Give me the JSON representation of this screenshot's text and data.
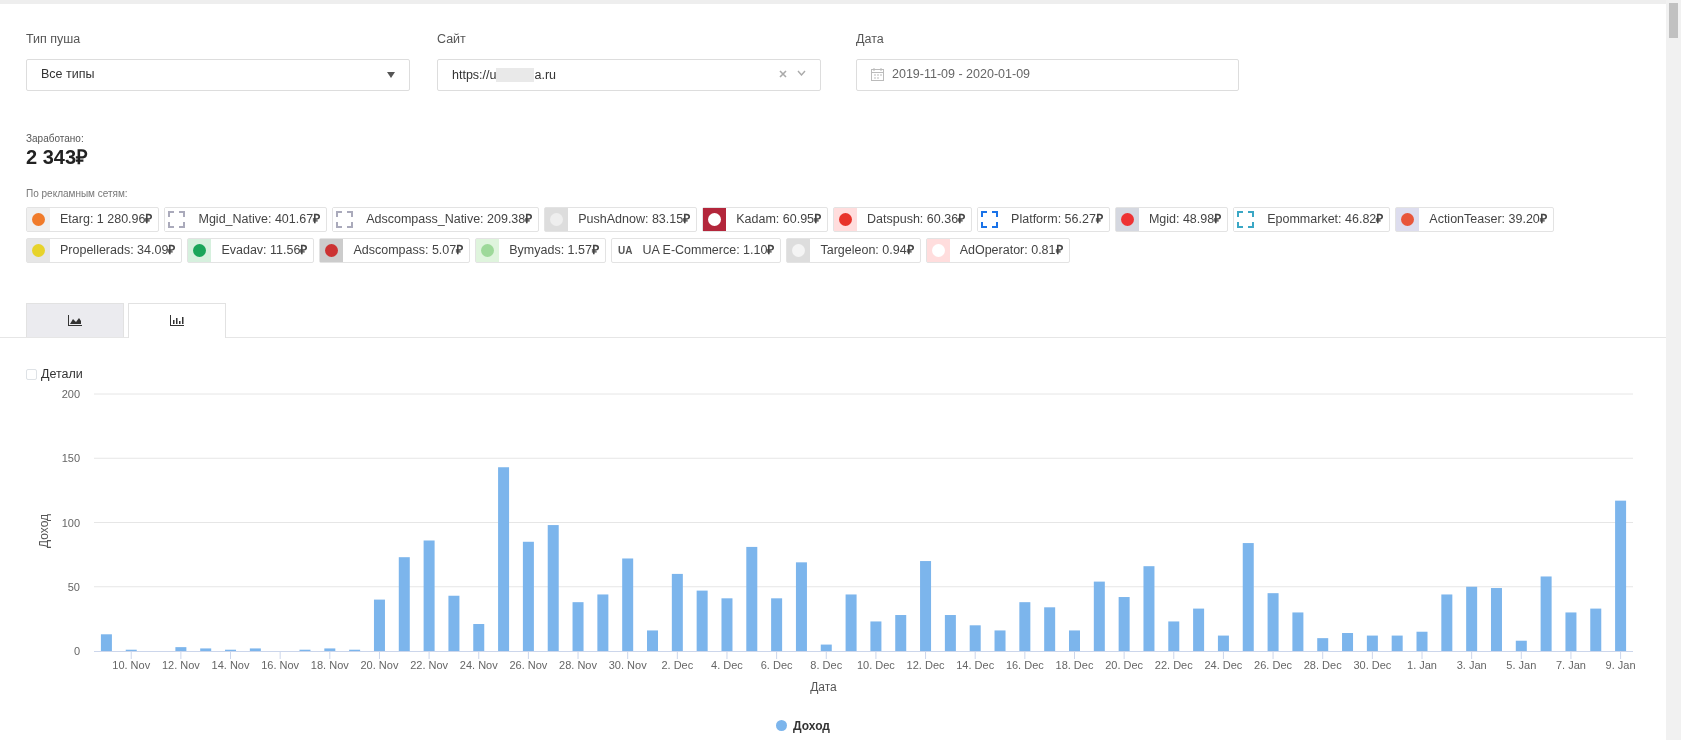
{
  "filters": [
    {
      "label": "Тип пуша",
      "kind": "select",
      "value": "Все типы"
    },
    {
      "label": "Сайт",
      "kind": "site",
      "value_start": "https://u",
      "value_end": "a.ru"
    },
    {
      "label": "Дата",
      "kind": "date",
      "value": "2019-11-09 - 2020-01-09"
    }
  ],
  "earned": {
    "label": "Заработано:",
    "value": "2 343₽"
  },
  "networks_label": "По рекламным сетям:",
  "network_rows": [
    {
      "items": [
        {
          "text": "Etarg: 1 280.96**₽**",
          "kind": "image-logo"
        },
        {
          "text": "Mgid_Native: 401.67**₽**",
          "kind": "image-logo"
        },
        {
          "text": "Adscompass_Native: 209.38**₽**",
          "kind": "image-logo"
        },
        {
          "text": "PushAdnow: 83.15**₽**",
          "kind": "image-logo"
        },
        {
          "text": "Kadam: 60.95**₽**",
          "kind": "image-logo"
        },
        {
          "text": "Datspush: 60.36**₽**",
          "kind": "image-logo"
        },
        {
          "text": "Platform: 56.27**₽**",
          "kind": "image-logo"
        },
        {
          "text": "Mgid: 48.98**₽**",
          "kind": "image-logo"
        },
        {
          "text": "Epommarket: 46.82**₽**",
          "kind": "image-logo"
        },
        {
          "text": "ActionTeaser: 39.20**₽**",
          "kind": "image-logo"
        }
      ]
    },
    {
      "items": [
        {
          "text": "Propellerads: 34.09**₽**",
          "kind": "image-logo"
        },
        {
          "text": "Evadav: 11.56**₽**",
          "kind": "image-logo"
        },
        {
          "text": "Adscompass: 5.07**₽**",
          "kind": "image-logo"
        },
        {
          "text": "Bymyads: 1.57**₽**",
          "kind": "image-logo"
        },
        {
          "text": "UA E-Commerce: 1.10**₽**",
          "kind": "text-logo",
          "logo_text": "UA"
        },
        {
          "text": "Targeleon: 0.94**₽**",
          "kind": "image-logo"
        },
        {
          "text": "AdOperator: 0.81**₽**",
          "kind": "image-logo"
        }
      ]
    }
  ],
  "chart_tabs": [
    {
      "selected": false
    },
    {
      "selected": true
    }
  ],
  "details": {
    "label": "Детали",
    "checked": false
  },
  "chart": {
    "chart_data": {
      "type": "bar",
      "grid": true,
      "xlabel": "Дата",
      "ylabel": "Доход",
      "ylim": [
        0,
        200
      ],
      "yticks": [
        0,
        50,
        100,
        150,
        200
      ],
      "categories": [
        null,
        "10. Nov",
        null,
        "12. Nov",
        null,
        "14. Nov",
        null,
        "16. Nov",
        null,
        "18. Nov",
        null,
        "20. Nov",
        null,
        "22. Nov",
        null,
        "24. Nov",
        null,
        "26. Nov",
        null,
        "28. Nov",
        null,
        "30. Nov",
        null,
        "2. Dec",
        null,
        "4. Dec",
        null,
        "6. Dec",
        null,
        "8. Dec",
        null,
        "10. Dec",
        null,
        "12. Dec",
        null,
        "14. Dec",
        null,
        "16. Dec",
        null,
        "18. Dec",
        null,
        "20. Dec",
        null,
        "22. Dec",
        null,
        "24. Dec",
        null,
        "26. Dec",
        null,
        "28. Dec",
        null,
        "30. Dec",
        null,
        "1. Jan",
        null,
        "3. Jan",
        null,
        "5. Jan",
        null,
        "7. Jan",
        null,
        "9. Jan"
      ],
      "series": [
        {
          "name": "Доход",
          "color": "#7cb5ec",
          "values": [
            13,
            1,
            0,
            3,
            2,
            1,
            2,
            0,
            1,
            2,
            1,
            40,
            73,
            86,
            43,
            21,
            143,
            85,
            98,
            38,
            44,
            72,
            16,
            60,
            47,
            41,
            81,
            41,
            69,
            5,
            44,
            23,
            28,
            70,
            28,
            20,
            16,
            38,
            34,
            16,
            54,
            42,
            66,
            23,
            33,
            12,
            84,
            45,
            30,
            10,
            14,
            12,
            12,
            15,
            44,
            50,
            49,
            8,
            58,
            30,
            33,
            117
          ]
        }
      ]
    }
  }
}
